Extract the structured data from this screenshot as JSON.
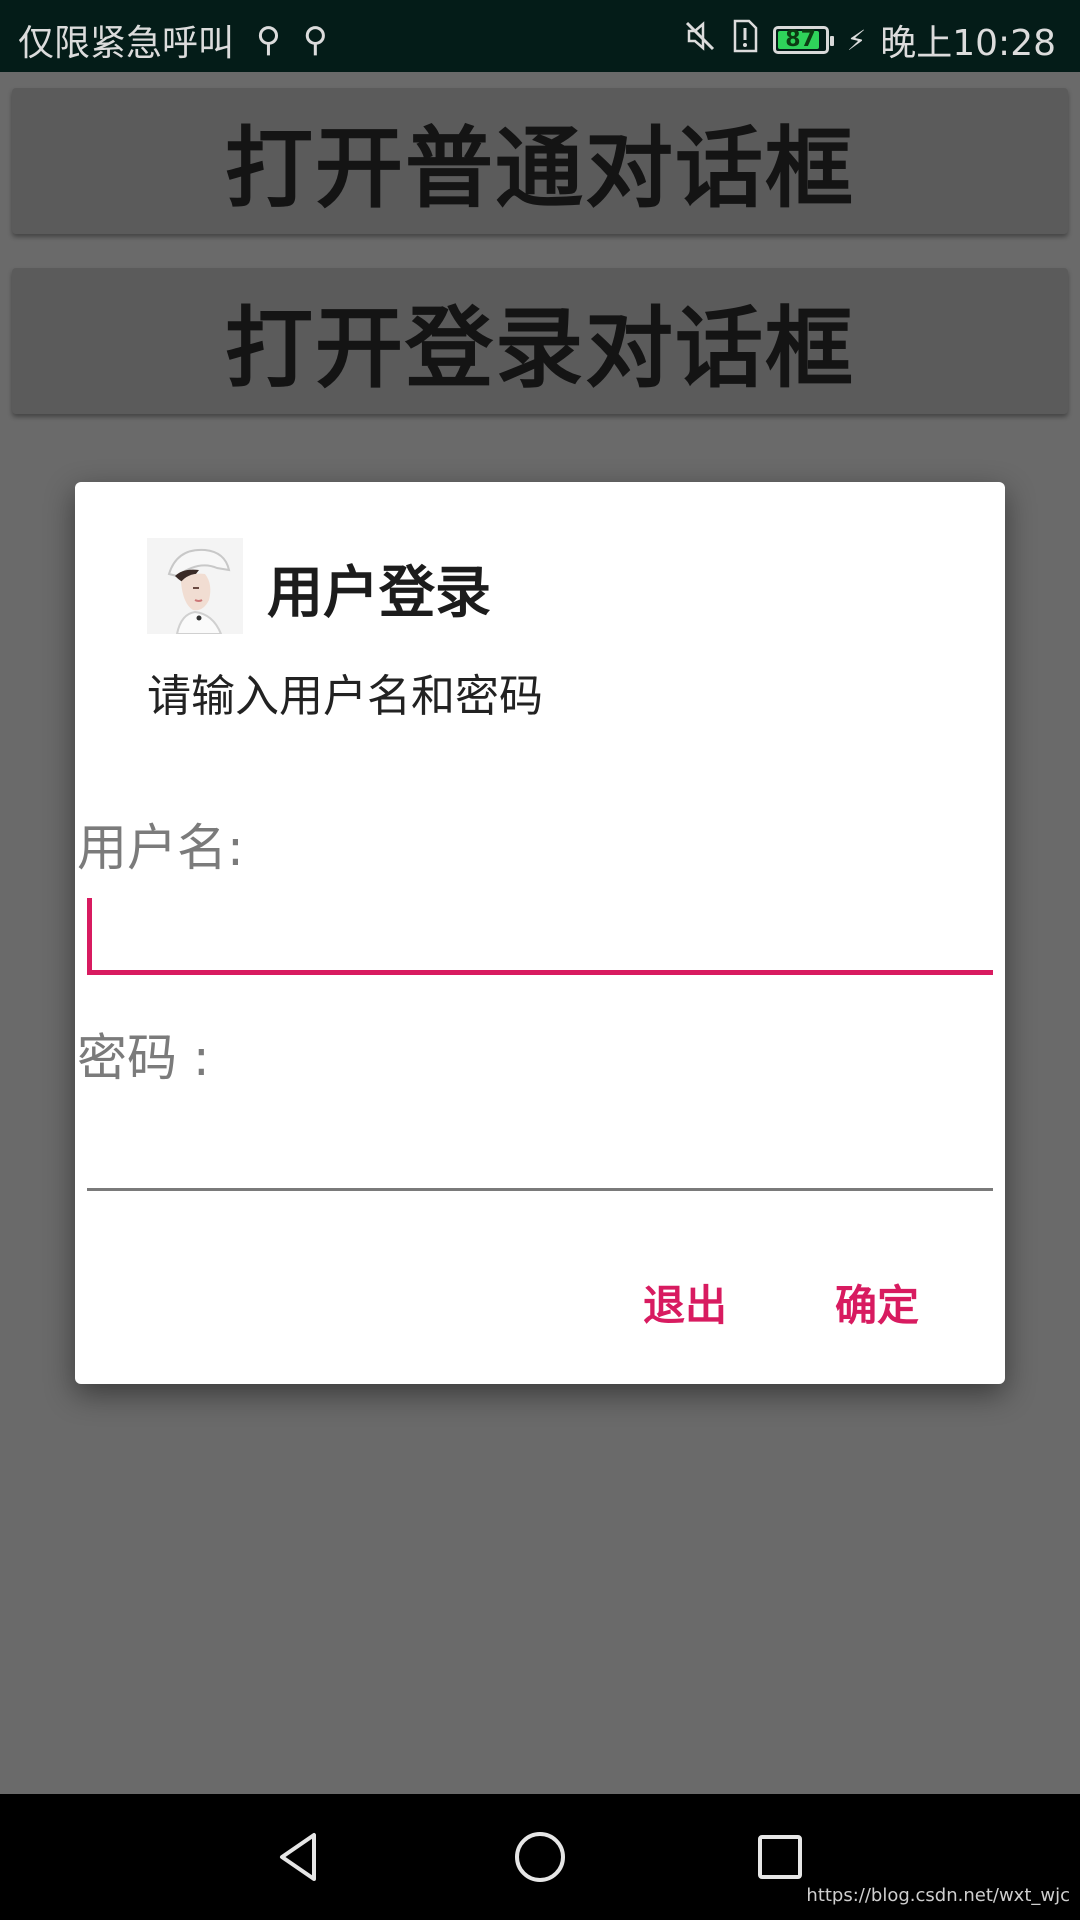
{
  "status_bar": {
    "carrier": "仅限紧急呼叫",
    "battery_level": "87",
    "time": "晚上10:28",
    "icons": [
      "usb-icon",
      "usb-icon",
      "mute-icon",
      "sim-alert-icon",
      "battery-icon",
      "charging-icon"
    ]
  },
  "main": {
    "open_normal_dialog_label": "打开普通对话框",
    "open_login_dialog_label": "打开登录对话框"
  },
  "dialog": {
    "title": "用户登录",
    "message": "请输入用户名和密码",
    "username_label": "用户名:",
    "username_value": "",
    "password_label": "密码 :",
    "password_value": "",
    "exit_label": "退出",
    "confirm_label": "确定",
    "accent_color": "#d81b60"
  },
  "nav_bar": {
    "icons": [
      "back-icon",
      "home-icon",
      "recents-icon"
    ]
  },
  "watermark": "https://blog.csdn.net/wxt_wjc"
}
